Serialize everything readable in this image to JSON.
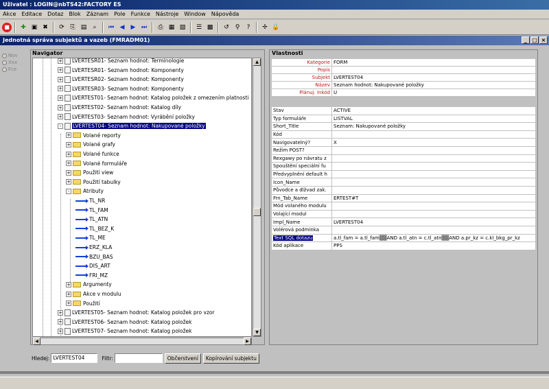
{
  "app": {
    "title": "Uživatel : LOGIN@nbTS42:FACTORY ES"
  },
  "menu": [
    "Akce",
    "Editace",
    "Dotaz",
    "Blok",
    "Záznam",
    "Pole",
    "Funkce",
    "Nástroje",
    "Window",
    "Nápověda"
  ],
  "toolbar_icons": [
    "stop-icon",
    "insert-icon",
    "save-icon",
    "delete-icon",
    "refresh-icon",
    "copy-icon",
    "paste-icon",
    "find-icon",
    "first-icon",
    "prev-icon",
    "next-icon",
    "last-icon",
    "print-icon",
    "preview-icon",
    "export-icon",
    "list-icon",
    "calendar-icon",
    "undo-icon",
    "search-icon",
    "help-icon",
    "pin-icon",
    "lock-icon"
  ],
  "window": {
    "title": "Jednotná správa subjektů a vazeb (FMRADM01)",
    "buttons": [
      "_",
      "□",
      "×"
    ]
  },
  "mode_radios": [
    "Nov",
    "Xxx",
    "Fce"
  ],
  "navigator": {
    "title": "Navigator",
    "nodes": [
      {
        "type": "doc",
        "expander": "+",
        "label": "LVERTESR01- Seznam hodnot: Terminologie"
      },
      {
        "type": "doc",
        "expander": "+",
        "label": "LVERTESR01- Seznam hodnot: Komponenty"
      },
      {
        "type": "doc",
        "expander": "+",
        "label": "LVERTESR02- Seznam hodnot: Komponenty"
      },
      {
        "type": "doc",
        "expander": "+",
        "label": "LVERTESR03- Seznam hodnot: Komponenty"
      },
      {
        "type": "doc",
        "expander": "+",
        "label": "LVERTEST01- Seznam hodnot: Katalog položek z omezením platnosti"
      },
      {
        "type": "doc",
        "expander": "+",
        "label": "LVERTEST02- Seznam hodnot: Katalog díly"
      },
      {
        "type": "doc",
        "expander": "+",
        "label": "LVERTEST03- Seznam hodnot: Vyrábění položky"
      },
      {
        "type": "doc",
        "expander": "-",
        "label": "LVERTEST04- Seznam hodnot: Nakupované položky",
        "selected": true
      },
      {
        "type": "folder",
        "expander": "+",
        "label": "Volané reporty"
      },
      {
        "type": "folder",
        "expander": "+",
        "label": "Volané grafy"
      },
      {
        "type": "folder",
        "expander": "+",
        "label": "Volané funkce"
      },
      {
        "type": "folder",
        "expander": "+",
        "label": "Volané formuláře"
      },
      {
        "type": "folder",
        "expander": "+",
        "label": "Použití view"
      },
      {
        "type": "folder",
        "expander": "+",
        "label": "Použití tabulky"
      },
      {
        "type": "folder",
        "expander": "-",
        "label": "Atributy"
      },
      {
        "type": "attr",
        "label": "TL_NR"
      },
      {
        "type": "attr",
        "label": "TL_FAM"
      },
      {
        "type": "attr",
        "label": "TL_ATN"
      },
      {
        "type": "attr",
        "label": "TL_BEZ_K"
      },
      {
        "type": "attr",
        "label": "TL_ME"
      },
      {
        "type": "attr",
        "label": "ERZ_KLA"
      },
      {
        "type": "attr",
        "label": "BZU_BAS"
      },
      {
        "type": "attr",
        "label": "DIS_ART"
      },
      {
        "type": "attr",
        "label": "FRI_MZ"
      },
      {
        "type": "folder",
        "expander": "+",
        "label": "Argumenty"
      },
      {
        "type": "folder",
        "expander": "+",
        "label": "Akce v modulu"
      },
      {
        "type": "folder",
        "expander": "+",
        "label": "Použití"
      },
      {
        "type": "doc",
        "expander": "+",
        "label": "LVERTEST05- Seznam hodnot: Katalog položek pro vzor"
      },
      {
        "type": "doc",
        "expander": "+",
        "label": "LVERTEST06- Seznam hodnot: Katalog položek"
      },
      {
        "type": "doc",
        "expander": "+",
        "label": "LVERTEST07- Seznam hodnot: Katalog položek"
      }
    ]
  },
  "search": {
    "label": "Hledej:",
    "value": "LVERTEST04",
    "filter_label": "Filtr:",
    "filter_value": "",
    "refresh_button": "Občerstvení",
    "copy_button": "Kopírování subjektu"
  },
  "properties": {
    "title": "Vlastnosti",
    "header": [
      {
        "key": "Kategorie",
        "value": "FORM"
      },
      {
        "key": "Popis",
        "value": ""
      },
      {
        "key": "Subjekt",
        "value": "LVERTEST04"
      },
      {
        "key": "Název",
        "value": "Seznam hodnot: Nakupované položky"
      },
      {
        "key": "Plánuj. Inkód",
        "value": "U"
      }
    ],
    "rows": [
      {
        "key": "Stav",
        "value": "ACTIVE"
      },
      {
        "key": "Typ formuláře",
        "value": "LISTVAL"
      },
      {
        "key": "Short_Title",
        "value": "Seznam: Nakupované položky"
      },
      {
        "key": "Kód",
        "value": ""
      },
      {
        "key": "Navigovatelný?",
        "value": "X"
      },
      {
        "key": "Režim POST?",
        "value": ""
      },
      {
        "key": "Rexgawy po návratu z",
        "value": ""
      },
      {
        "key": "Spouštění speciální fu",
        "value": ""
      },
      {
        "key": "Předvyplnění default h",
        "value": ""
      },
      {
        "key": "Icon_Name",
        "value": ""
      },
      {
        "key": "Původce a dlžvad zak.",
        "value": ""
      },
      {
        "key": "Frn_Tab_Name",
        "value": "ERTEST#T"
      },
      {
        "key": "Mód volaného modulu",
        "value": ""
      },
      {
        "key": "Volající modul",
        "value": ""
      },
      {
        "key": "Impl_Name",
        "value": "LVERTEST04"
      },
      {
        "key": "Volérová podmínka",
        "value": ""
      },
      {
        "key": "Text SQL dotazu",
        "value": "a.tl_fam = a.tl_fam▒▒AND a.tl_atn = c.tl_atn▒▒AND a.pr_kz = c.kl_bkg_pr_kz",
        "highlight": true
      },
      {
        "key": "Kód aplikace",
        "value": "PPS"
      }
    ]
  }
}
